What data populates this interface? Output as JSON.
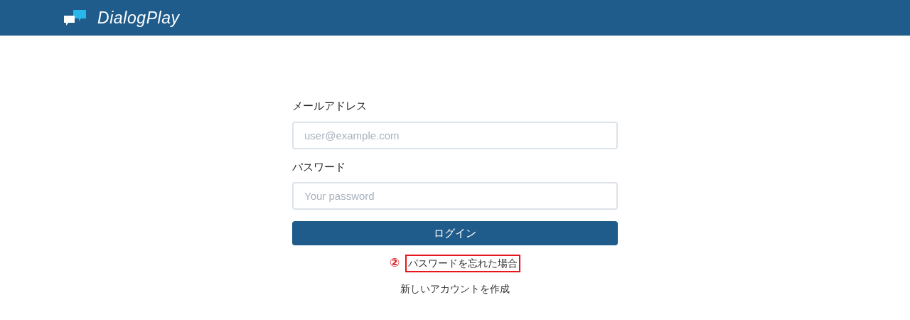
{
  "header": {
    "brand": "DialogPlay"
  },
  "form": {
    "fields": [
      {
        "label": "メールアドレス",
        "placeholder": "user@example.com"
      },
      {
        "label": "パスワード",
        "placeholder": "Your password"
      }
    ],
    "submit": "ログイン"
  },
  "links": [
    {
      "text": "パスワードを忘れた場合",
      "annotation": "②",
      "highlighted": true
    },
    {
      "text": "新しいアカウントを作成",
      "highlighted": false
    }
  ]
}
